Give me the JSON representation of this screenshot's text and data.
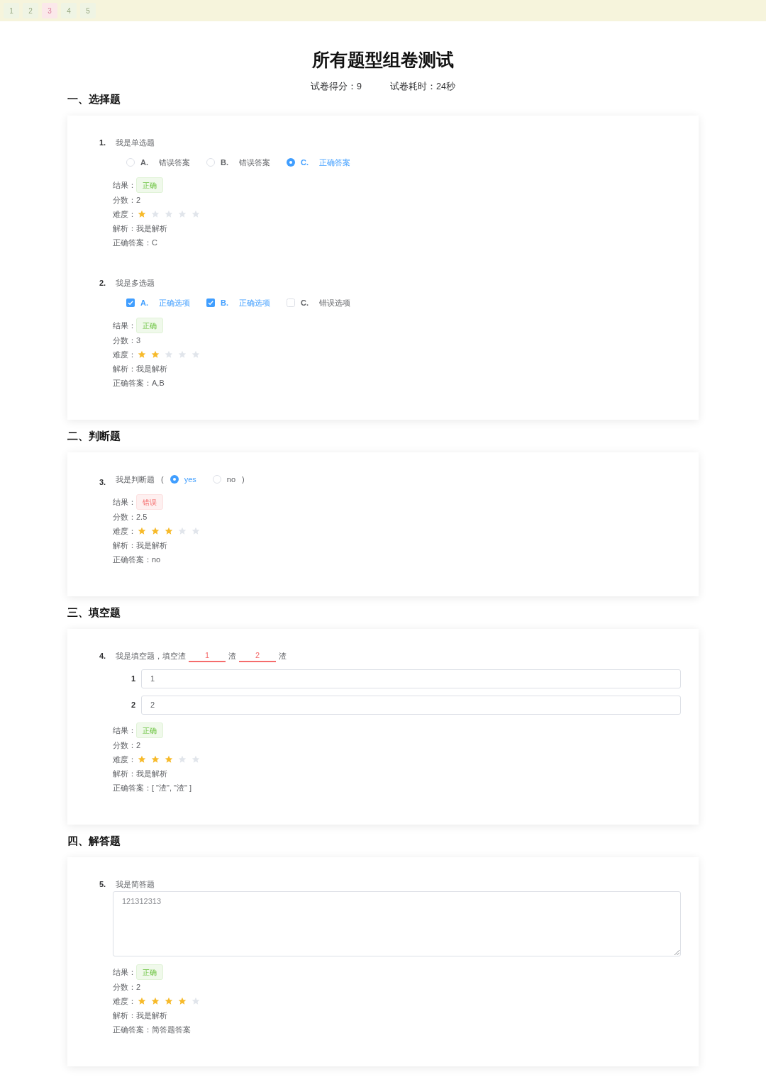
{
  "nav": [
    {
      "label": "1",
      "correct": true
    },
    {
      "label": "2",
      "correct": true
    },
    {
      "label": "3",
      "correct": false
    },
    {
      "label": "4",
      "correct": true
    },
    {
      "label": "5",
      "correct": true
    }
  ],
  "title": "所有题型组卷测试",
  "summary": [
    "试卷得分：9",
    "试卷耗时：24秒"
  ],
  "sections": [
    {
      "heading": "一、选择题",
      "questions": [
        {
          "kind": "single",
          "number": "1.",
          "text": "我是单选题",
          "options": [
            {
              "letter": "A.",
              "text": "错误答案",
              "selected": false
            },
            {
              "letter": "B.",
              "text": "错误答案",
              "selected": false
            },
            {
              "letter": "C.",
              "text": "正确答案",
              "selected": true
            }
          ],
          "result_label": "结果：",
          "result": "正确",
          "correct": true,
          "score": "分数：2",
          "difficulty_label": "难度：",
          "stars": 1,
          "analysis": "解析：我是解析",
          "answer": "正确答案：C"
        },
        {
          "kind": "multiple",
          "number": "2.",
          "text": "我是多选题",
          "options": [
            {
              "letter": "A.",
              "text": "正确选项",
              "checked": true
            },
            {
              "letter": "B.",
              "text": "正确选项",
              "checked": true
            },
            {
              "letter": "C.",
              "text": "错误选项",
              "checked": false
            }
          ],
          "result_label": "结果：",
          "result": "正确",
          "correct": true,
          "score": "分数：3",
          "difficulty_label": "难度：",
          "stars": 2,
          "analysis": "解析：我是解析",
          "answer": "正确答案：A,B"
        }
      ]
    },
    {
      "heading": "二、判断题",
      "questions": [
        {
          "kind": "judge",
          "number": "3.",
          "text": "我是判断题",
          "open": "(",
          "options": [
            {
              "text": "yes",
              "selected": true
            },
            {
              "text": "no",
              "selected": false
            }
          ],
          "close": ")",
          "result_label": "结果：",
          "result": "错误",
          "correct": false,
          "score": "分数：2.5",
          "difficulty_label": "难度：",
          "stars": 3,
          "analysis": "解析：我是解析",
          "answer": "正确答案：no"
        }
      ]
    },
    {
      "heading": "三、填空题",
      "questions": [
        {
          "kind": "fill",
          "number": "4.",
          "segments": [
            {
              "kind": "text",
              "text": "我是填空题，填空渣"
            },
            {
              "kind": "blank",
              "text": "1"
            },
            {
              "kind": "text",
              "text": "渣"
            },
            {
              "kind": "blank",
              "text": "2"
            },
            {
              "kind": "text",
              "text": "渣"
            }
          ],
          "inputs": [
            {
              "label": "1",
              "value": "1"
            },
            {
              "label": "2",
              "value": "2"
            }
          ],
          "result_label": "结果：",
          "result": "正确",
          "correct": true,
          "score": "分数：2",
          "difficulty_label": "难度：",
          "stars": 3,
          "analysis": "解析：我是解析",
          "answer": "正确答案：[ \"渣\", \"渣\" ]"
        }
      ]
    },
    {
      "heading": "四、解答题",
      "questions": [
        {
          "kind": "essay",
          "number": "5.",
          "text": "我是简答题",
          "response": "121312313",
          "result_label": "结果：",
          "result": "正确",
          "correct": true,
          "score": "分数：2",
          "difficulty_label": "难度：",
          "stars": 4,
          "analysis": "解析：我是解析",
          "answer": "正确答案：简答题答案"
        }
      ]
    }
  ]
}
